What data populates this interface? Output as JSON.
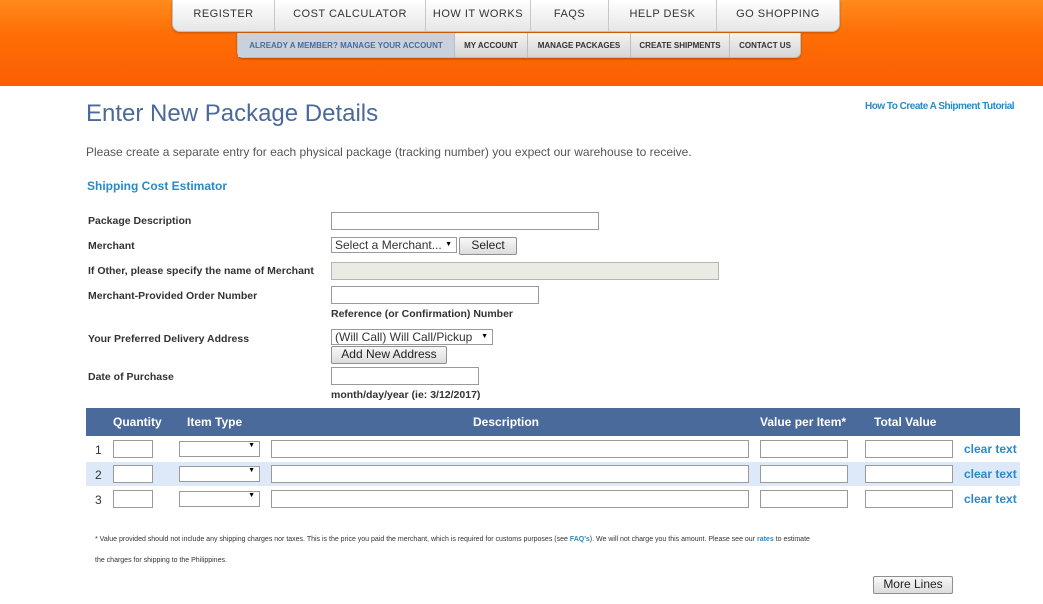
{
  "top_nav": [
    "REGISTER",
    "COST CALCULATOR",
    "HOW IT WORKS",
    "FAQS",
    "HELP DESK",
    "GO SHOPPING"
  ],
  "sub_nav": [
    "ALREADY A MEMBER? MANAGE YOUR ACCOUNT",
    "MY ACCOUNT",
    "MANAGE PACKAGES",
    "CREATE SHIPMENTS",
    "CONTACT US"
  ],
  "page": {
    "title": "Enter New Package Details",
    "tutorial_link": "How To Create A  Shipment Tutorial",
    "intro": "Please create a separate entry for each physical package (tracking number) you expect our warehouse to receive.",
    "section_title": "Shipping Cost Estimator"
  },
  "form": {
    "package_description_label": "Package Description",
    "package_description_value": "",
    "merchant_label": "Merchant",
    "merchant_select_value": "Select a Merchant...",
    "merchant_button": "Select",
    "other_merchant_label": "If Other, please specify the name of Merchant",
    "other_merchant_value": "",
    "order_number_label": "Merchant-Provided Order Number",
    "order_number_value": "",
    "order_number_hint": "Reference (or Confirmation) Number",
    "address_label": "Your Preferred Delivery Address",
    "address_select_value": "(Will Call) Will Call/Pickup",
    "add_address_button": "Add New Address",
    "date_label": "Date of Purchase",
    "date_value": "",
    "date_hint": "month/day/year (ie: 3/12/2017)"
  },
  "table": {
    "headers": {
      "quantity": "Quantity",
      "item_type": "Item Type",
      "description": "Description",
      "value_per_item": "Value per Item*",
      "total_value": "Total Value"
    },
    "rows": [
      {
        "num": "1",
        "clear": "clear text"
      },
      {
        "num": "2",
        "clear": "clear text"
      },
      {
        "num": "3",
        "clear": "clear text"
      }
    ]
  },
  "footnote": {
    "part1": "* Value provided should not include any shipping charges nor taxes. This is the price you paid the merchant, which is required for customs purposes (see ",
    "faq_link": "FAQ's",
    "part2": "). We will not charge you this amount. Please see our ",
    "rates_link": "rates",
    "part3": " to estimate",
    "line2": "the charges for shipping to the Philippines."
  },
  "more_lines_button": "More Lines",
  "colors": {
    "header_orange": "#ff6e05",
    "accent_blue": "#4a6a9c",
    "link_blue": "#2a8ac6",
    "alt_row": "#dde8f8"
  }
}
